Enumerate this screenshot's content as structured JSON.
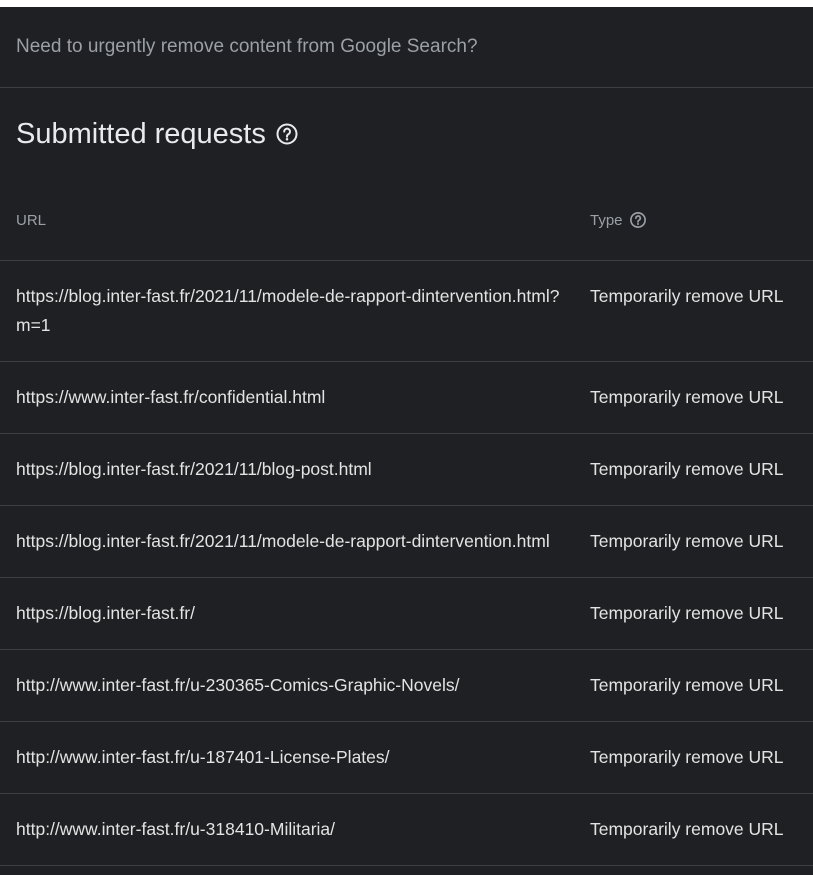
{
  "notice": "Need to urgently remove content from Google Search?",
  "section": {
    "title": "Submitted requests"
  },
  "table": {
    "headers": {
      "url": "URL",
      "type": "Type"
    },
    "rows": [
      {
        "url": "https://blog.inter-fast.fr/2021/11/modele-de-rapport-dintervention.html?m=1",
        "type": "Temporarily remove URL"
      },
      {
        "url": "https://www.inter-fast.fr/confidential.html",
        "type": "Temporarily remove URL"
      },
      {
        "url": "https://blog.inter-fast.fr/2021/11/blog-post.html",
        "type": "Temporarily remove URL"
      },
      {
        "url": "https://blog.inter-fast.fr/2021/11/modele-de-rapport-dintervention.html",
        "type": "Temporarily remove URL"
      },
      {
        "url": "https://blog.inter-fast.fr/",
        "type": "Temporarily remove URL"
      },
      {
        "url": "http://www.inter-fast.fr/u-230365-Comics-Graphic-Novels/",
        "type": "Temporarily remove URL"
      },
      {
        "url": "http://www.inter-fast.fr/u-187401-License-Plates/",
        "type": "Temporarily remove URL"
      },
      {
        "url": "http://www.inter-fast.fr/u-318410-Militaria/",
        "type": "Temporarily remove URL"
      }
    ]
  },
  "icons": {
    "help": "help-circle-icon"
  },
  "colors": {
    "background": "#1f2023",
    "divider": "#3c4043",
    "text_primary": "#e3e3e3",
    "text_secondary": "#9aa0a6"
  }
}
